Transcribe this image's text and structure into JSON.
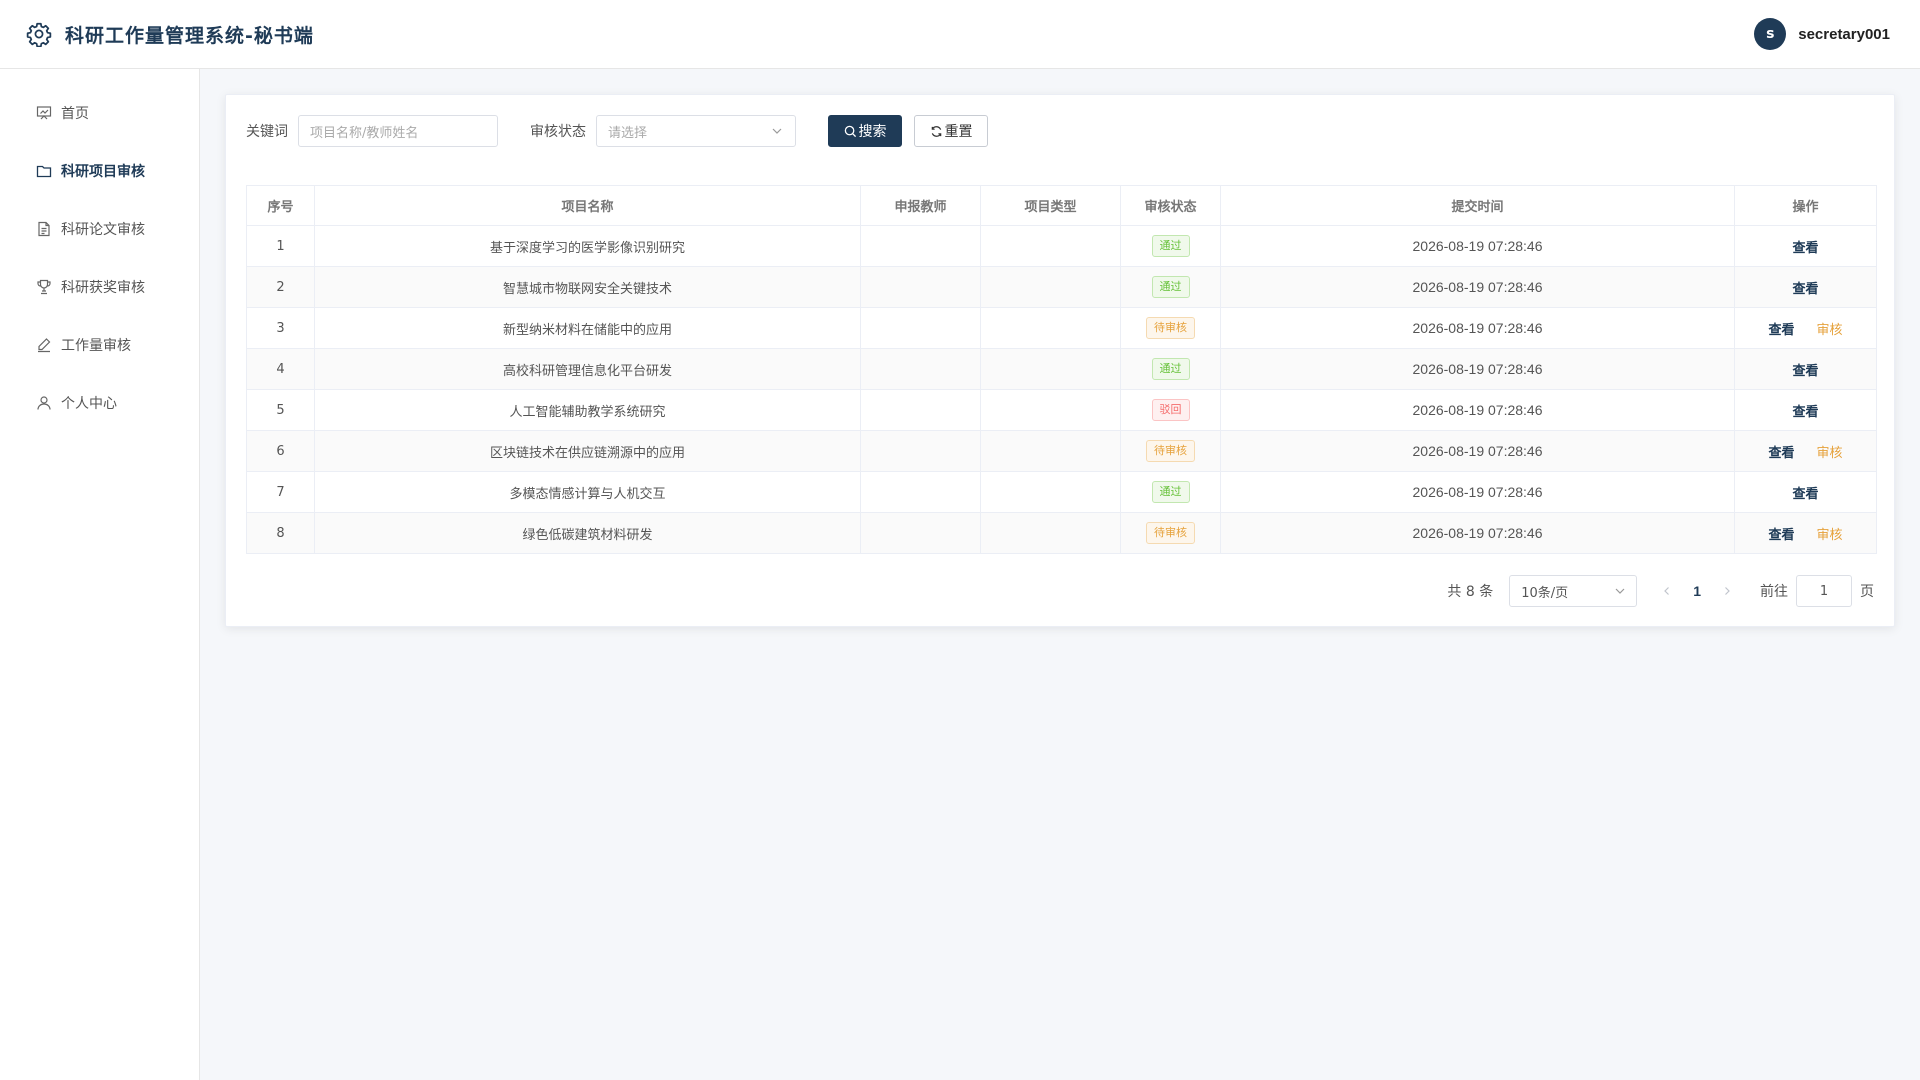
{
  "header": {
    "title": "科研工作量管理系统-秘书端",
    "avatar_letter": "s",
    "username": "secretary001",
    "brand_color": "#1f3b57"
  },
  "sidebar": {
    "items": [
      {
        "label": "首页",
        "icon": "presentation-board-icon"
      },
      {
        "label": "科研项目审核",
        "icon": "folder-icon",
        "active": true
      },
      {
        "label": "科研论文审核",
        "icon": "document-icon"
      },
      {
        "label": "科研获奖审核",
        "icon": "trophy-icon"
      },
      {
        "label": "工作量审核",
        "icon": "edit-pen-icon"
      },
      {
        "label": "个人中心",
        "icon": "user-icon"
      }
    ]
  },
  "filters": {
    "keyword_label": "关键词",
    "keyword_placeholder": "项目名称/教师姓名",
    "status_label": "审核状态",
    "status_placeholder": "请选择",
    "search_button": "搜索",
    "reset_button": "重置"
  },
  "table": {
    "columns": [
      "序号",
      "项目名称",
      "申报教师",
      "项目类型",
      "审核状态",
      "提交时间",
      "操作"
    ],
    "rows": [
      {
        "index": "1",
        "name": "基于深度学习的医学影像识别研究",
        "teacher": "",
        "type": "",
        "status": "通过",
        "status_kind": "success",
        "time": "2026-08-19 07:28:46",
        "view": "查看"
      },
      {
        "index": "2",
        "name": "智慧城市物联网安全关键技术",
        "teacher": "",
        "type": "",
        "status": "通过",
        "status_kind": "success",
        "time": "2026-08-19 07:28:46",
        "view": "查看"
      },
      {
        "index": "3",
        "name": "新型纳米材料在储能中的应用",
        "teacher": "",
        "type": "",
        "status": "待审核",
        "status_kind": "warning",
        "time": "2026-08-19 07:28:46",
        "view": "查看",
        "audit": "审核"
      },
      {
        "index": "4",
        "name": "高校科研管理信息化平台研发",
        "teacher": "",
        "type": "",
        "status": "通过",
        "status_kind": "success",
        "time": "2026-08-19 07:28:46",
        "view": "查看"
      },
      {
        "index": "5",
        "name": "人工智能辅助教学系统研究",
        "teacher": "",
        "type": "",
        "status": "驳回",
        "status_kind": "danger",
        "time": "2026-08-19 07:28:46",
        "view": "查看"
      },
      {
        "index": "6",
        "name": "区块链技术在供应链溯源中的应用",
        "teacher": "",
        "type": "",
        "status": "待审核",
        "status_kind": "warning",
        "time": "2026-08-19 07:28:46",
        "view": "查看",
        "audit": "审核"
      },
      {
        "index": "7",
        "name": "多模态情感计算与人机交互",
        "teacher": "",
        "type": "",
        "status": "通过",
        "status_kind": "success",
        "time": "2026-08-19 07:28:46",
        "view": "查看"
      },
      {
        "index": "8",
        "name": "绿色低碳建筑材料研发",
        "teacher": "",
        "type": "",
        "status": "待审核",
        "status_kind": "warning",
        "time": "2026-08-19 07:28:46",
        "view": "查看",
        "audit": "审核"
      }
    ]
  },
  "status_colors": {
    "success": {
      "text": "#67c23a",
      "bg": "#f0f9eb",
      "border": "#c2e7b0"
    },
    "warning": {
      "text": "#e6a23c",
      "bg": "#fdf6ec",
      "border": "#f5dab1"
    },
    "danger": {
      "text": "#f56c6c",
      "bg": "#fef0f0",
      "border": "#fbc4c4"
    }
  },
  "pagination": {
    "total": "共 8 条",
    "page_size": "10条/页",
    "current_page": "1",
    "goto_label": "前往",
    "goto_value": "1",
    "page_unit": "页"
  }
}
